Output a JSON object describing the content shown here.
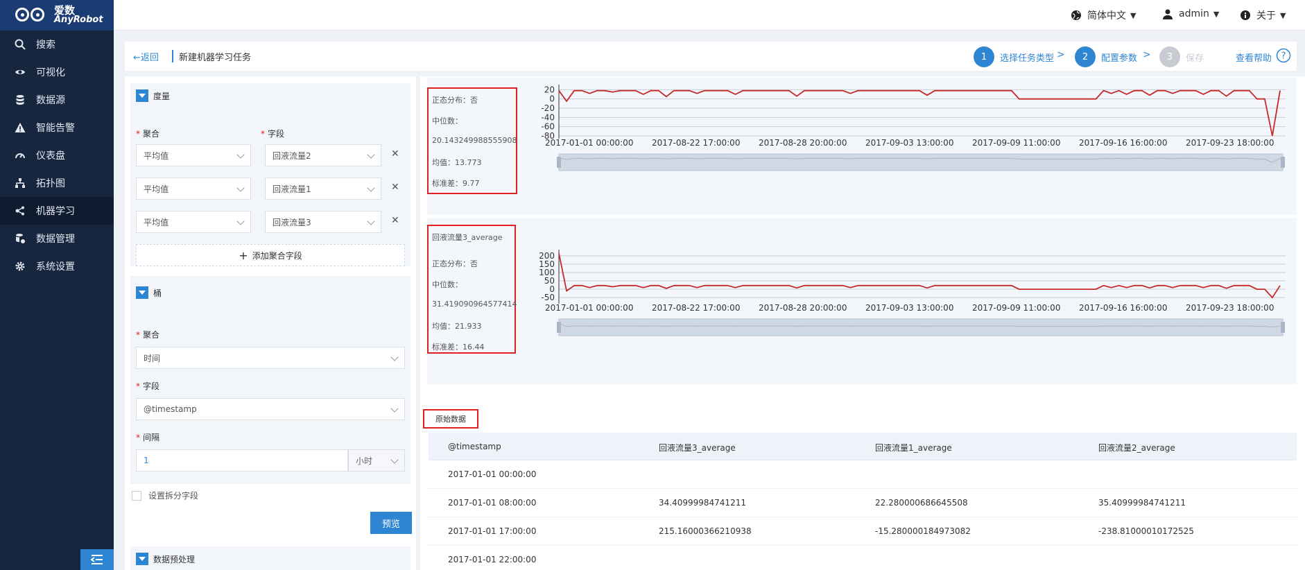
{
  "app": {
    "brand_cn": "爱数",
    "brand_en": "AnyRobot"
  },
  "sidebar": {
    "items": [
      {
        "label": "搜索",
        "icon": "search-icon"
      },
      {
        "label": "可视化",
        "icon": "eye-icon"
      },
      {
        "label": "数据源",
        "icon": "database-icon"
      },
      {
        "label": "智能告警",
        "icon": "warning-icon"
      },
      {
        "label": "仪表盘",
        "icon": "gauge-icon"
      },
      {
        "label": "拓扑图",
        "icon": "topology-icon"
      },
      {
        "label": "机器学习",
        "icon": "ml-icon",
        "active": true
      },
      {
        "label": "数据管理",
        "icon": "data-manage-icon"
      },
      {
        "label": "系统设置",
        "icon": "gear-icon"
      }
    ]
  },
  "topbar": {
    "language": "简体中文",
    "user": "admin",
    "about": "关于"
  },
  "header": {
    "back": "←返回",
    "title": "新建机器学习任务",
    "steps": [
      {
        "num": "1",
        "label": "选择任务类型"
      },
      {
        "num": "2",
        "label": "配置参数"
      },
      {
        "num": "3",
        "label": "保存"
      }
    ],
    "help": "查看帮助"
  },
  "metrics": {
    "title": "度量",
    "agg_label": "聚合",
    "field_label": "字段",
    "rows": [
      {
        "agg": "平均值",
        "field": "回液流量2"
      },
      {
        "agg": "平均值",
        "field": "回液流量1"
      },
      {
        "agg": "平均值",
        "field": "回液流量3"
      }
    ],
    "add_label": "添加聚合字段"
  },
  "bucket": {
    "title": "桶",
    "agg_label": "聚合",
    "agg_value": "时间",
    "field_label": "字段",
    "field_value": "@timestamp",
    "interval_label": "间隔",
    "interval_value": "1",
    "interval_unit": "小时"
  },
  "split_label": "设置拆分字段",
  "preview_label": "预览",
  "preprocess_title": "数据预处理",
  "charts": [
    {
      "series_name": "",
      "normal": "正态分布：否",
      "median_label": "中位数：",
      "median": "20.143249988555908",
      "mean": "均值：13.773",
      "std": "标准差：9.77"
    },
    {
      "series_name": "回液流量3_average",
      "normal": "正态分布：否",
      "median_label": "中位数：",
      "median": "31.419090964577414",
      "mean": "均值：21.933",
      "std": "标准差：16.44"
    }
  ],
  "chart_data": [
    {
      "type": "line",
      "x_ticks": [
        "2017-01-01 00:00:00",
        "2017-08-22 17:00:00",
        "2017-08-28 20:00:00",
        "2017-09-03 13:00:00",
        "2017-09-09 11:00:00",
        "2017-09-16 16:00:00",
        "2017-09-23 18:00:00"
      ],
      "y_ticks": [
        20,
        0,
        -20,
        -40,
        -60,
        -80
      ],
      "ylim": [
        -80,
        25
      ],
      "color": "#c62828",
      "series": [
        {
          "values": [
            18,
            -5,
            18,
            18,
            12,
            18,
            18,
            15,
            18,
            18,
            18,
            10,
            18,
            18,
            5,
            18,
            18,
            18,
            12,
            18,
            18,
            18,
            18,
            10,
            18,
            18,
            18,
            18,
            18,
            18,
            18,
            6,
            18,
            18,
            18,
            18,
            18,
            18,
            12,
            18,
            18,
            18,
            18,
            18,
            18,
            18,
            18,
            18,
            8,
            18,
            18,
            18,
            18,
            18,
            18,
            18,
            18,
            18,
            18,
            18,
            0,
            0,
            0,
            0,
            0,
            0,
            0,
            0,
            0,
            0,
            0,
            18,
            12,
            18,
            10,
            18,
            18,
            8,
            18,
            18,
            12,
            18,
            18,
            18,
            10,
            18,
            18,
            6,
            18,
            18,
            18,
            0,
            0,
            -80,
            18
          ]
        }
      ]
    },
    {
      "type": "line",
      "x_ticks": [
        "2017-01-01 00:00:00",
        "2017-08-22 17:00:00",
        "2017-08-28 20:00:00",
        "2017-09-03 13:00:00",
        "2017-09-09 11:00:00",
        "2017-09-16 16:00:00",
        "2017-09-23 18:00:00"
      ],
      "y_ticks": [
        200,
        150,
        100,
        50,
        0,
        -50
      ],
      "ylim": [
        -70,
        220
      ],
      "color": "#c62828",
      "series": [
        {
          "values": [
            215,
            -10,
            22,
            22,
            10,
            22,
            22,
            15,
            22,
            22,
            22,
            10,
            22,
            22,
            5,
            22,
            22,
            22,
            10,
            22,
            22,
            22,
            22,
            10,
            22,
            22,
            22,
            22,
            22,
            22,
            22,
            8,
            22,
            22,
            22,
            22,
            22,
            22,
            10,
            22,
            22,
            22,
            22,
            22,
            22,
            22,
            22,
            22,
            8,
            22,
            22,
            22,
            22,
            22,
            22,
            22,
            22,
            22,
            22,
            22,
            0,
            0,
            0,
            0,
            0,
            0,
            0,
            0,
            0,
            0,
            0,
            22,
            10,
            22,
            10,
            22,
            22,
            8,
            22,
            22,
            10,
            22,
            22,
            22,
            10,
            22,
            22,
            6,
            22,
            22,
            22,
            0,
            0,
            -50,
            22
          ]
        }
      ]
    }
  ],
  "raw_data": {
    "tab": "原始数据",
    "columns": [
      "@timestamp",
      "回液流量3_average",
      "回液流量1_average",
      "回液流量2_average"
    ],
    "rows": [
      [
        "2017-01-01 00:00:00",
        "",
        "",
        ""
      ],
      [
        "2017-01-01 08:00:00",
        "34.40999984741211",
        "22.280000686645508",
        "35.40999984741211"
      ],
      [
        "2017-01-01 17:00:00",
        "215.16000366210938",
        "-15.280000184973082",
        "-238.81000010172525"
      ],
      [
        "2017-01-01 22:00:00",
        "",
        "",
        ""
      ]
    ]
  }
}
